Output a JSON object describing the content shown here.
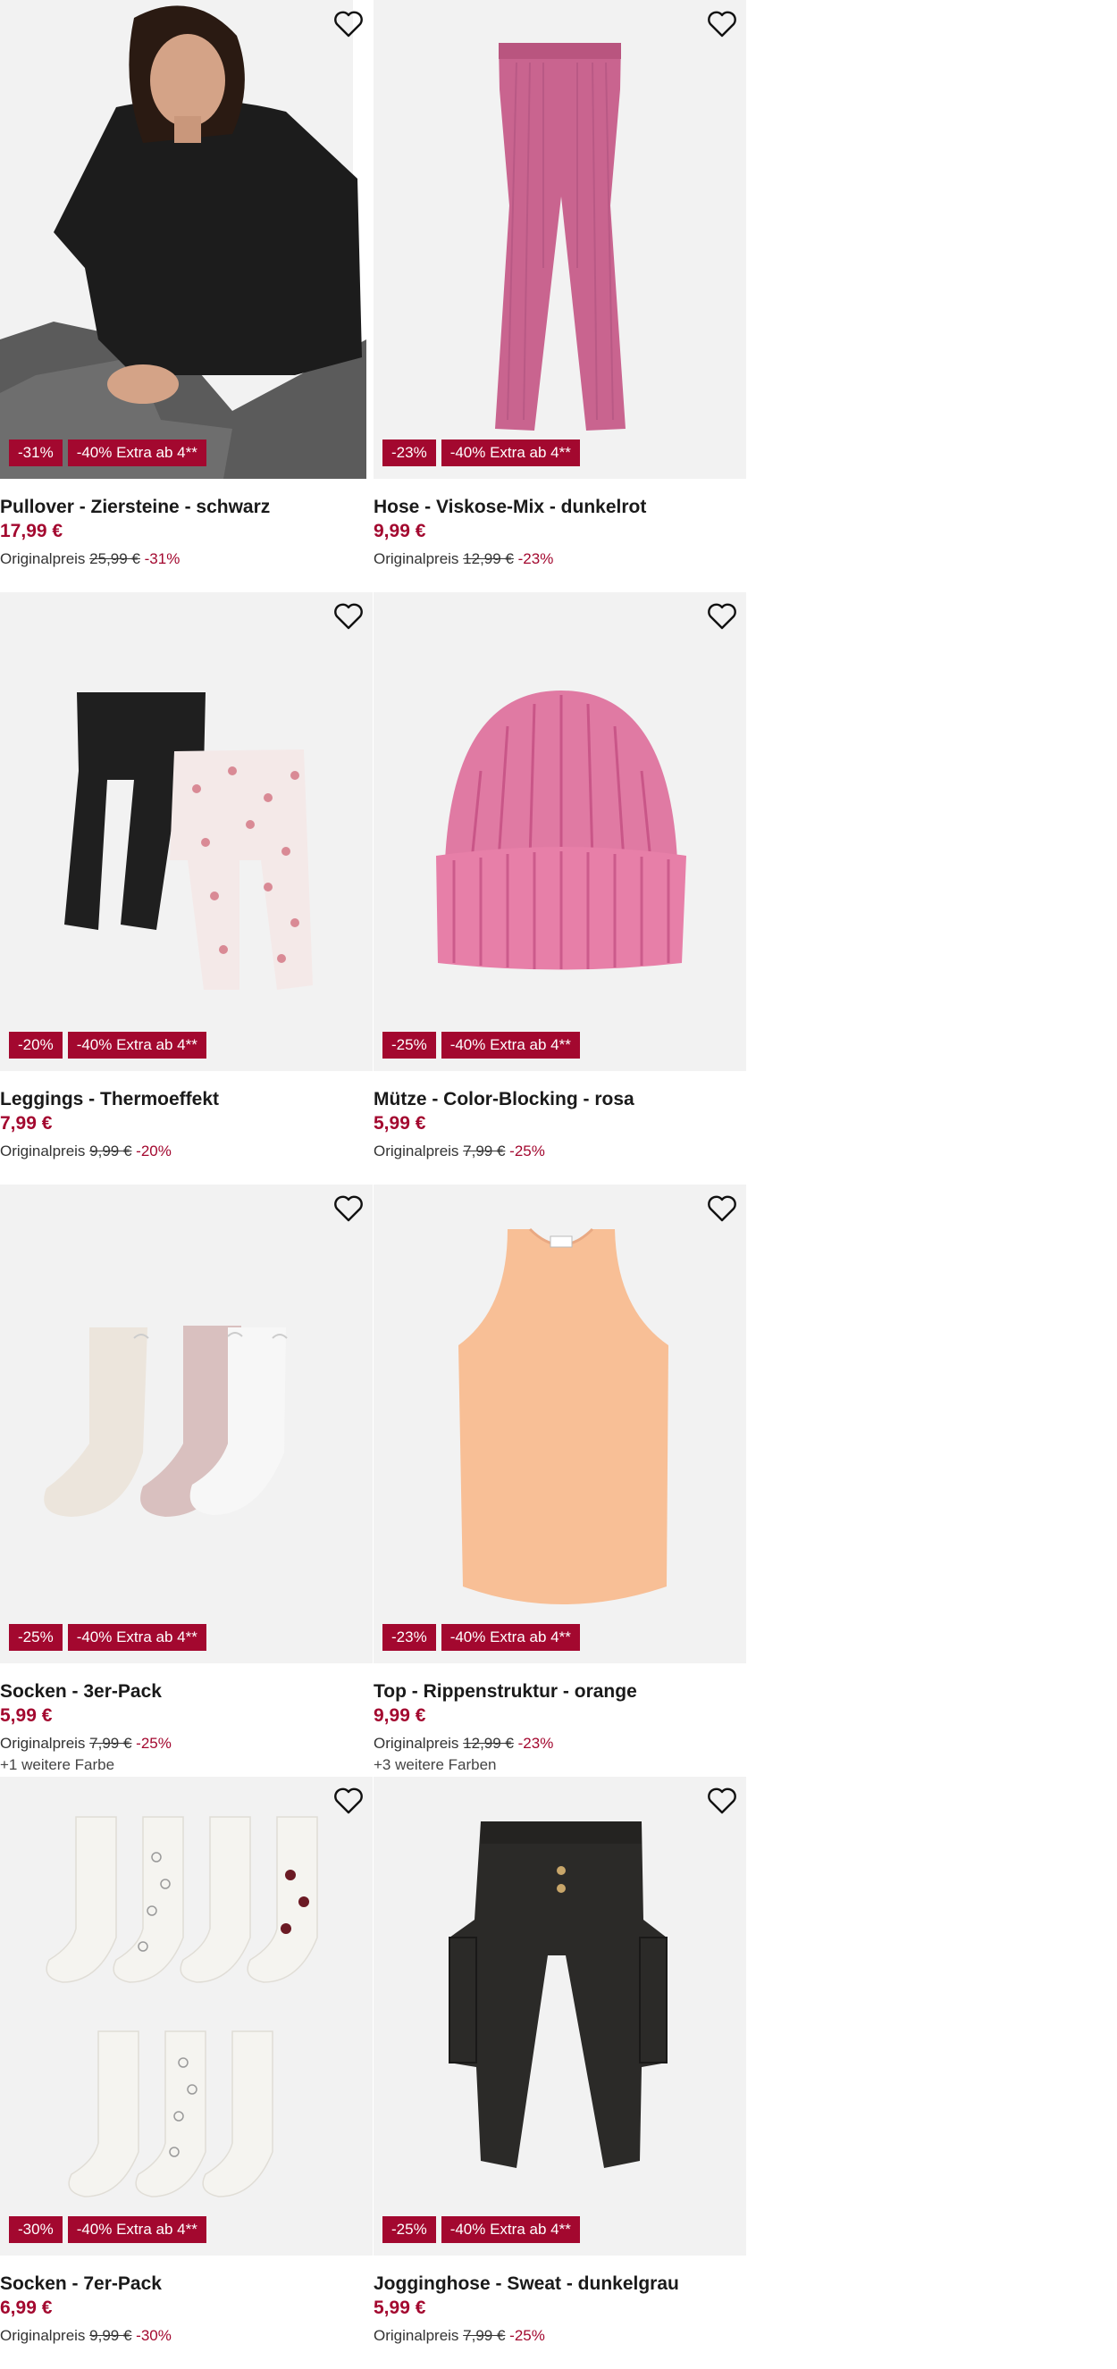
{
  "products": [
    {
      "title": "Pullover - Ziersteine - schwarz",
      "price": "17,99 €",
      "orig_label": "Originalpreis",
      "orig_price": "25,99 €",
      "pct": "-31%",
      "badge_discount": "-31%",
      "badge_extra": "-40% Extra ab 4**",
      "more_colors": "",
      "image": "woman-black-sweater"
    },
    {
      "title": "Hose - Viskose-Mix - dunkelrot",
      "price": "9,99 €",
      "orig_label": "Originalpreis",
      "orig_price": "12,99 €",
      "pct": "-23%",
      "badge_discount": "-23%",
      "badge_extra": "-40% Extra ab 4**",
      "more_colors": "",
      "image": "pink-ribbed-flared-pants"
    },
    {
      "title": "Leggings - Thermoeffekt",
      "price": "7,99 €",
      "orig_label": "Originalpreis",
      "orig_price": "9,99 €",
      "pct": "-20%",
      "badge_discount": "-20%",
      "badge_extra": "-40% Extra ab 4**",
      "more_colors": "",
      "image": "two-kids-leggings"
    },
    {
      "title": "Mütze - Color-Blocking - rosa",
      "price": "5,99 €",
      "orig_label": "Originalpreis",
      "orig_price": "7,99 €",
      "pct": "-25%",
      "badge_discount": "-25%",
      "badge_extra": "-40% Extra ab 4**",
      "more_colors": "",
      "image": "pink-beanie"
    },
    {
      "title": "Socken - 3er-Pack",
      "price": "5,99 €",
      "orig_label": "Originalpreis",
      "orig_price": "7,99 €",
      "pct": "-25%",
      "badge_discount": "-25%",
      "badge_extra": "-40% Extra ab 4**",
      "more_colors": "+1 weitere Farbe",
      "image": "three-pastel-socks"
    },
    {
      "title": "Top - Rippenstruktur - orange",
      "price": "9,99 €",
      "orig_label": "Originalpreis",
      "orig_price": "12,99 €",
      "pct": "-23%",
      "badge_discount": "-23%",
      "badge_extra": "-40% Extra ab 4**",
      "more_colors": "+3 weitere Farben",
      "image": "orange-ribbed-tank-top"
    },
    {
      "title": "Socken - 7er-Pack",
      "price": "6,99 €",
      "orig_label": "Originalpreis",
      "orig_price": "9,99 €",
      "pct": "-30%",
      "badge_discount": "-30%",
      "badge_extra": "-40% Extra ab 4**",
      "more_colors": "",
      "image": "seven-white-heart-socks"
    },
    {
      "title": "Jogginghose - Sweat - dunkelgrau",
      "price": "5,99 €",
      "orig_label": "Originalpreis",
      "orig_price": "7,99 €",
      "pct": "-25%",
      "badge_discount": "-25%",
      "badge_extra": "-40% Extra ab 4**",
      "more_colors": "",
      "image": "dark-grey-jogging-pants"
    }
  ],
  "colors": {
    "accent": "#a3082f",
    "image_bg": "#f2f2f2",
    "text": "#1a1a1a"
  },
  "icons": {
    "wishlist": "heart-outline-icon"
  }
}
